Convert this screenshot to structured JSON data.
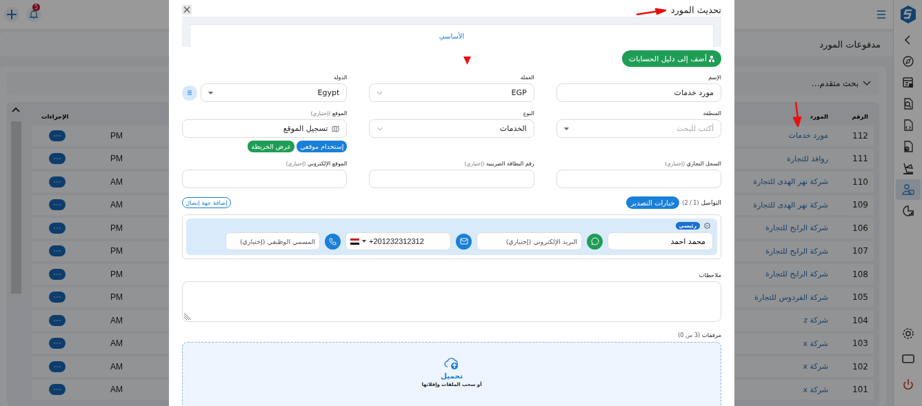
{
  "top_bar": {
    "notification_count": "5"
  },
  "sidebar": {
    "items": [
      {
        "kind": "back",
        "selected": false
      },
      {
        "kind": "compass",
        "selected": false
      },
      {
        "kind": "dashboard",
        "selected": false
      },
      {
        "kind": "search-doc",
        "selected": false
      },
      {
        "kind": "doc",
        "selected": false
      },
      {
        "kind": "doc-clock",
        "selected": false
      },
      {
        "kind": "forklift",
        "selected": false
      },
      {
        "kind": "users",
        "selected": true
      },
      {
        "kind": "chart",
        "selected": false
      }
    ],
    "bottom_items": [
      {
        "kind": "settings"
      },
      {
        "kind": "screen"
      },
      {
        "kind": "power"
      }
    ]
  },
  "page_title": "مدفوعات المورد",
  "advanced_search": "بحث متقدم...",
  "table": {
    "columns": [
      "الرقم",
      "المورد",
      "الإجراءات"
    ],
    "rows": [
      {
        "number": "112",
        "supplier": "مورد خدمات",
        "time": "PM"
      },
      {
        "number": "111",
        "supplier": "روافد للتجارة",
        "time": "PM"
      },
      {
        "number": "110",
        "supplier": "شركة  نهر الهدى للتجارة",
        "time": "AM"
      },
      {
        "number": "109",
        "supplier": "شركة  نهر الهدى للتجارة",
        "time": "AM"
      },
      {
        "number": "106",
        "supplier": "شركة الرابح للتجارة",
        "time": "PM"
      },
      {
        "number": "107",
        "supplier": "شركة الرابح للتجارة",
        "time": "PM"
      },
      {
        "number": "108",
        "supplier": "شركة الرابح للتجارة",
        "time": "PM"
      },
      {
        "number": "105",
        "supplier": "شركة الفردوس للتجارة",
        "time": "PM"
      },
      {
        "number": "104",
        "supplier": "شركة z",
        "time": "AM"
      },
      {
        "number": "103",
        "supplier": "شركة x",
        "time": "AM"
      },
      {
        "number": "102",
        "supplier": "شركة x",
        "time": "AM"
      },
      {
        "number": "101",
        "supplier": "شركة x",
        "time": "AM"
      }
    ]
  },
  "modal": {
    "title": "تحديث المورد",
    "tabs": [
      {
        "label": "الأساسي",
        "selected": true
      }
    ],
    "add_to_accounts_button": "أضف إلى دليل الحسابات",
    "fields": [
      {
        "kind": "text",
        "label": "الإسم",
        "value": "مورد خدمات"
      },
      {
        "kind": "select",
        "label": "العملة",
        "value": "EGP"
      },
      {
        "kind": "dropdown",
        "label": "الدولة",
        "value": "Egypt"
      },
      {
        "kind": "dropdown",
        "label": "المنطقة",
        "placeholder": "أكتب للبحث"
      },
      {
        "kind": "select",
        "label": "النوع",
        "value": "الخدمات"
      },
      {
        "kind": "location",
        "label": "الموقع",
        "optional": "(إختياري)",
        "value": "تسجيل الموقع"
      },
      {
        "kind": "text",
        "label": "السجل التجاري",
        "optional": "(إختياري)"
      },
      {
        "kind": "text",
        "label": "رقم البطاقة الضريبية",
        "optional": "(إختياري)"
      },
      {
        "kind": "text",
        "label": "الموقع الإلكتروني",
        "optional": "(إختياري)"
      }
    ],
    "location_buttons": [
      "إستخدام موقعي",
      "عرض الخريطة"
    ],
    "contacts": {
      "label": "التواصل",
      "count": "(1 / 2)",
      "export_button": "خيارات التصدير",
      "add_button": "إضافة جهة إتصال",
      "items": [
        {
          "badge": "رئيسي",
          "name": "محمد احمد",
          "email_placeholder": "البريد الإلكتروني (إختياري)",
          "phone": "+201232312312",
          "job_placeholder": "المسمي الوظيفي (إختياري)"
        }
      ]
    },
    "notes": {
      "label": "ملاحظات"
    },
    "attachments": {
      "label": "مرفقات",
      "count": "(3 من 0)",
      "upload_title": "تحميل",
      "upload_hint": "أو سحب الملفات وإفلاتها"
    }
  }
}
